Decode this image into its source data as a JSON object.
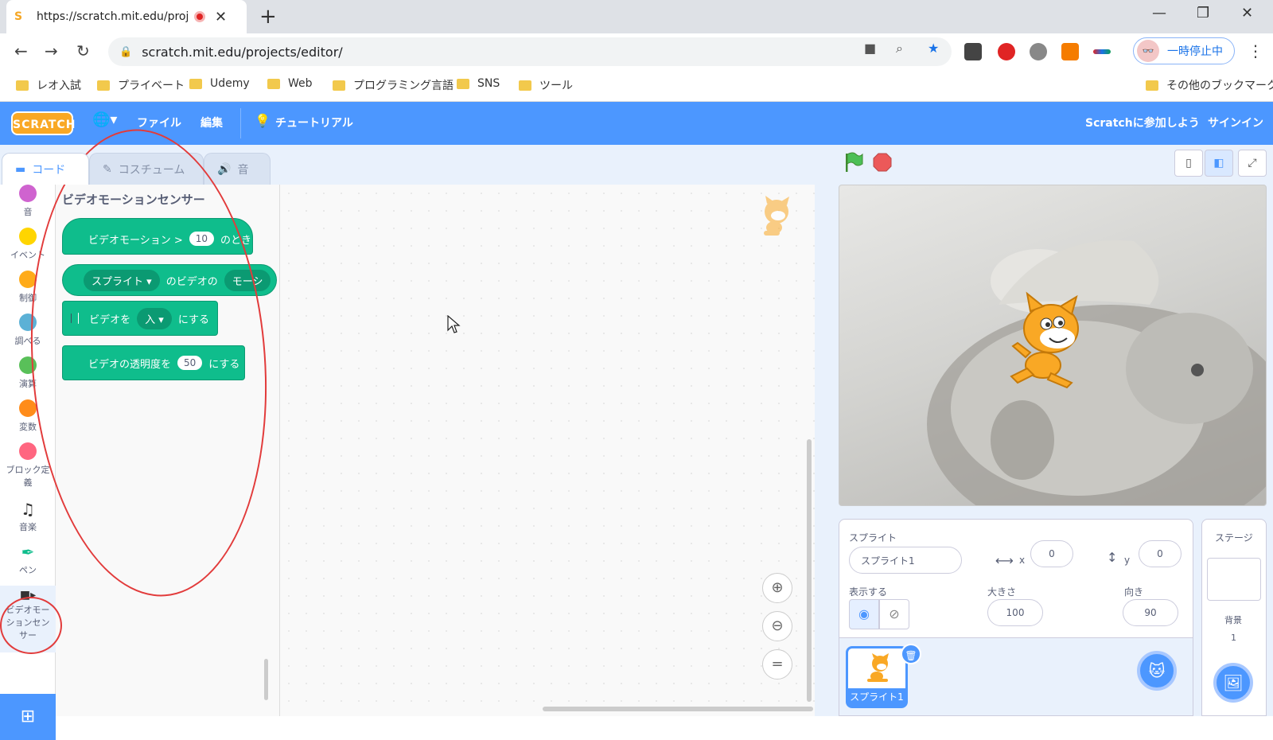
{
  "browser": {
    "tab_title": "https://scratch.mit.edu/proje",
    "url": "scratch.mit.edu/projects/editor/",
    "profile_label": "一時停止中",
    "bookmarks": [
      "レオ入試",
      "プライベート",
      "Udemy",
      "Web",
      "プログラミング言語",
      "SNS",
      "ツール"
    ],
    "other_bookmarks": "その他のブックマーク"
  },
  "menubar": {
    "logo": "SCRATCH",
    "file": "ファイル",
    "edit": "編集",
    "tutorial": "チュートリアル",
    "join": "Scratchに参加しよう",
    "signin": "サインイン"
  },
  "tabs": {
    "code": "コード",
    "costume": "コスチューム",
    "sound": "音"
  },
  "categories": [
    {
      "label": "音",
      "color": "#cf63cf"
    },
    {
      "label": "イベント",
      "color": "#ffd500"
    },
    {
      "label": "制御",
      "color": "#ffab19"
    },
    {
      "label": "調べる",
      "color": "#5cb1d6"
    },
    {
      "label": "演算",
      "color": "#59c059"
    },
    {
      "label": "変数",
      "color": "#ff8c1a"
    },
    {
      "label": "ブロック定義",
      "color": "#ff6680"
    },
    {
      "label": "音楽",
      "icon": "music-note-icon"
    },
    {
      "label": "ペン",
      "icon": "pen-icon"
    },
    {
      "label": "ビデオモーションセンサー",
      "icon": "video-camera-icon"
    }
  ],
  "flyout": {
    "title": "ビデオモーションセンサー",
    "blocks": [
      {
        "text1": "ビデオモーション >",
        "input": "10",
        "text2": "のとき"
      },
      {
        "dropdown": "スプライト",
        "text1": "のビデオの",
        "text2": "モーシ"
      },
      {
        "text1": "ビデオを",
        "dropdown": "入",
        "text2": "にする"
      },
      {
        "text1": "ビデオの透明度を",
        "input": "50",
        "text2": "にする"
      }
    ]
  },
  "sprite_info": {
    "sprite_label": "スプライト",
    "sprite_name": "スプライト1",
    "x_label": "x",
    "x_value": "0",
    "y_label": "y",
    "y_value": "0",
    "show_label": "表示する",
    "size_label": "大きさ",
    "size_value": "100",
    "direction_label": "向き",
    "direction_value": "90"
  },
  "sprite_list": {
    "sprite_name": "スプライト1"
  },
  "stage_panel": {
    "title": "ステージ",
    "backdrop_label": "背景",
    "backdrop_count": "1"
  }
}
